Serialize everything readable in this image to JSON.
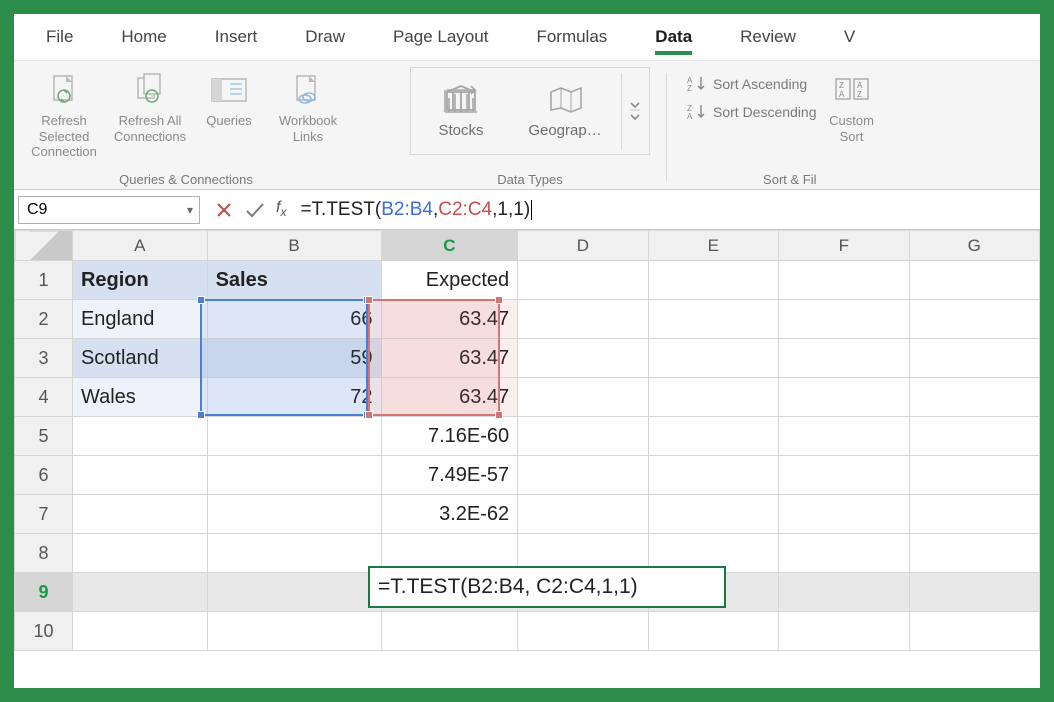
{
  "tabs": {
    "file": "File",
    "home": "Home",
    "insert": "Insert",
    "draw": "Draw",
    "pagelayout": "Page Layout",
    "formulas": "Formulas",
    "data": "Data",
    "review": "Review",
    "viewpartial": "V"
  },
  "ribbon": {
    "refresh_selected": "Refresh Selected Connection",
    "refresh_all": "Refresh All Connections",
    "queries": "Queries",
    "workbook_links": "Workbook Links",
    "group1_label": "Queries & Connections",
    "stocks": "Stocks",
    "geog": "Geograp…",
    "group2_label": "Data Types",
    "sort_asc": "Sort Ascending",
    "sort_desc": "Sort Descending",
    "custom_sort": "Custom Sort",
    "group3_label": "Sort & Fil"
  },
  "formula_bar": {
    "cell_ref": "C9",
    "prefix": "=T.TEST(",
    "range1": "B2:B4",
    "mid": ", ",
    "range2": "C2:C4",
    "suffix": ",1,1)"
  },
  "columns": {
    "A": "A",
    "B": "B",
    "C": "C",
    "D": "D",
    "E": "E",
    "F": "F",
    "G": "G"
  },
  "rows": {
    "1": "1",
    "2": "2",
    "3": "3",
    "4": "4",
    "5": "5",
    "6": "6",
    "7": "7",
    "8": "8",
    "9": "9",
    "10": "10"
  },
  "cells": {
    "A1": "Region",
    "B1": "Sales",
    "C1": "Expected",
    "A2": "England",
    "B2": "66",
    "C2": "63.47",
    "A3": "Scotland",
    "B3": "59",
    "C3": "63.47",
    "A4": "Wales",
    "B4": "72",
    "C4": "63.47",
    "C5": "7.16E-60",
    "C6": "7.49E-57",
    "C7": "3.2E-62",
    "C9_formula": "=T.TEST(B2:B4, C2:C4,1,1)"
  },
  "colors": {
    "accent": "#2C8E4A",
    "range_blue": "#4a7fd8",
    "range_red": "#d67373"
  }
}
